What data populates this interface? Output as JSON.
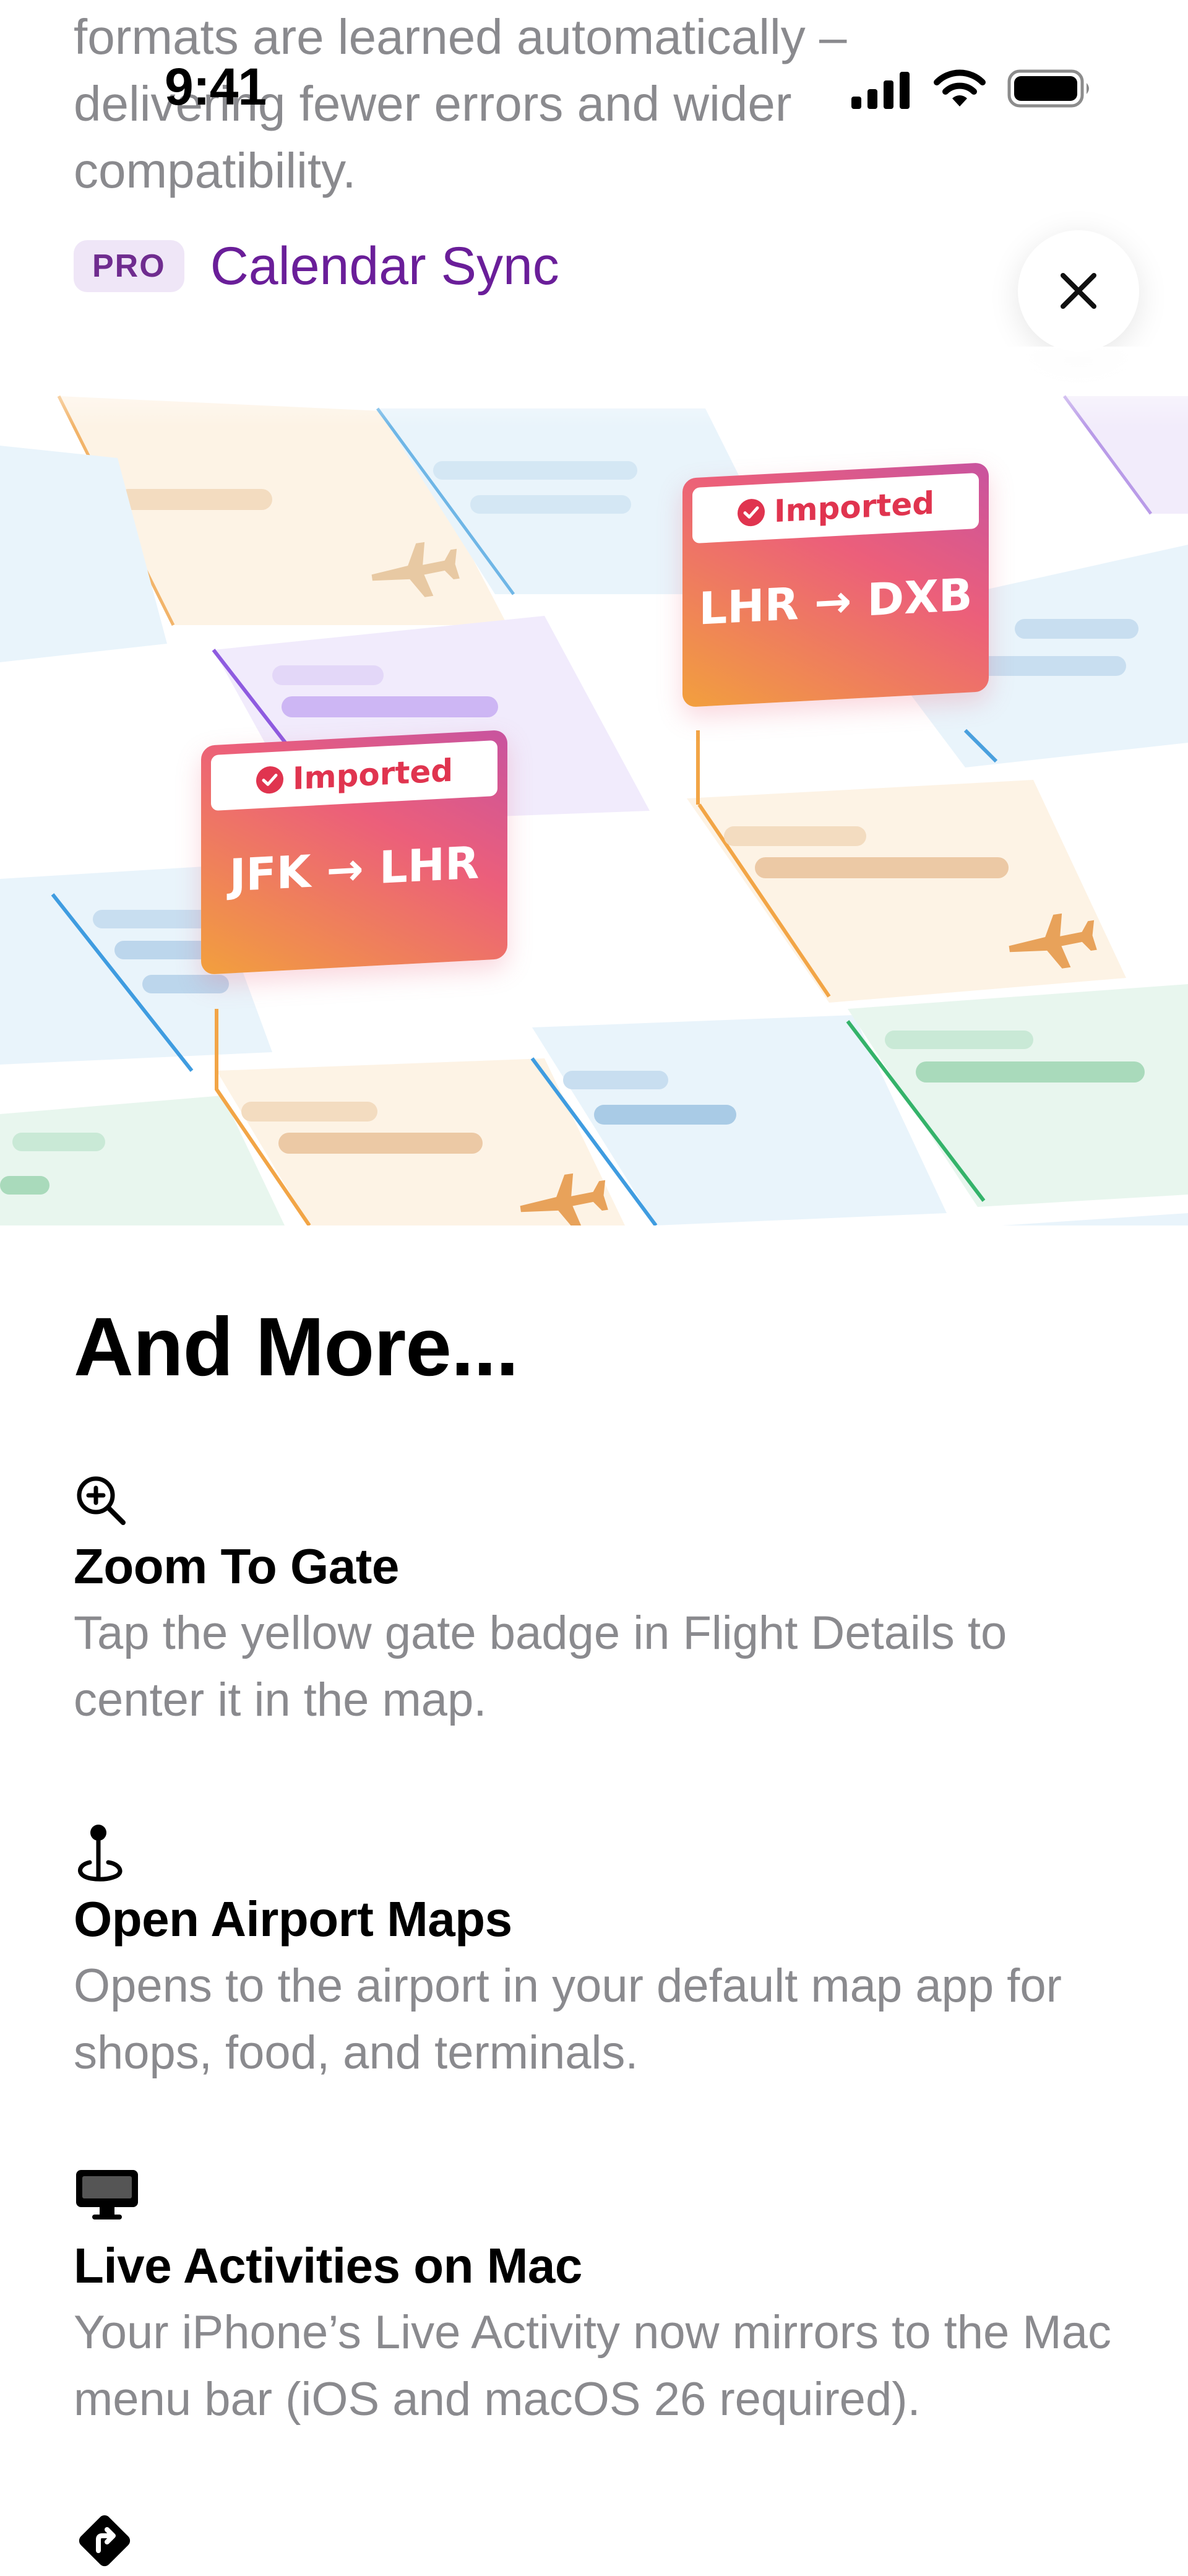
{
  "intro": {
    "text": "formats are learned automatically – delivering fewer errors and wider compatibility."
  },
  "status_bar": {
    "time": "9:41",
    "icons": [
      "cellular-signal-icon",
      "wifi-icon",
      "battery-icon"
    ]
  },
  "feature_header": {
    "badge": "PRO",
    "title": "Calendar Sync"
  },
  "close_button": {
    "icon": "close-icon"
  },
  "illustration": {
    "cards": [
      {
        "status": "Imported",
        "route": "JFK → LHR"
      },
      {
        "status": "Imported",
        "route": "LHR → DXB"
      }
    ],
    "colors": {
      "orange": "#f2a03d",
      "magenta": "#c8539f",
      "check": "#e0344f"
    }
  },
  "more": {
    "title": "And More...",
    "items": [
      {
        "icon": "zoom-in-icon",
        "title": "Zoom To Gate",
        "description": "Tap the yellow gate badge in Flight Details to center it in the map."
      },
      {
        "icon": "map-pin-icon",
        "title": "Open Airport Maps",
        "description": "Opens to the airport in your default map app for shops, food, and terminals."
      },
      {
        "icon": "desktop-computer-icon",
        "title": "Live Activities on Mac",
        "description": "Your iPhone’s Live Activity now mirrors to the Mac menu bar (iOS and macOS 26 required)."
      },
      {
        "icon": "directions-icon"
      }
    ]
  }
}
